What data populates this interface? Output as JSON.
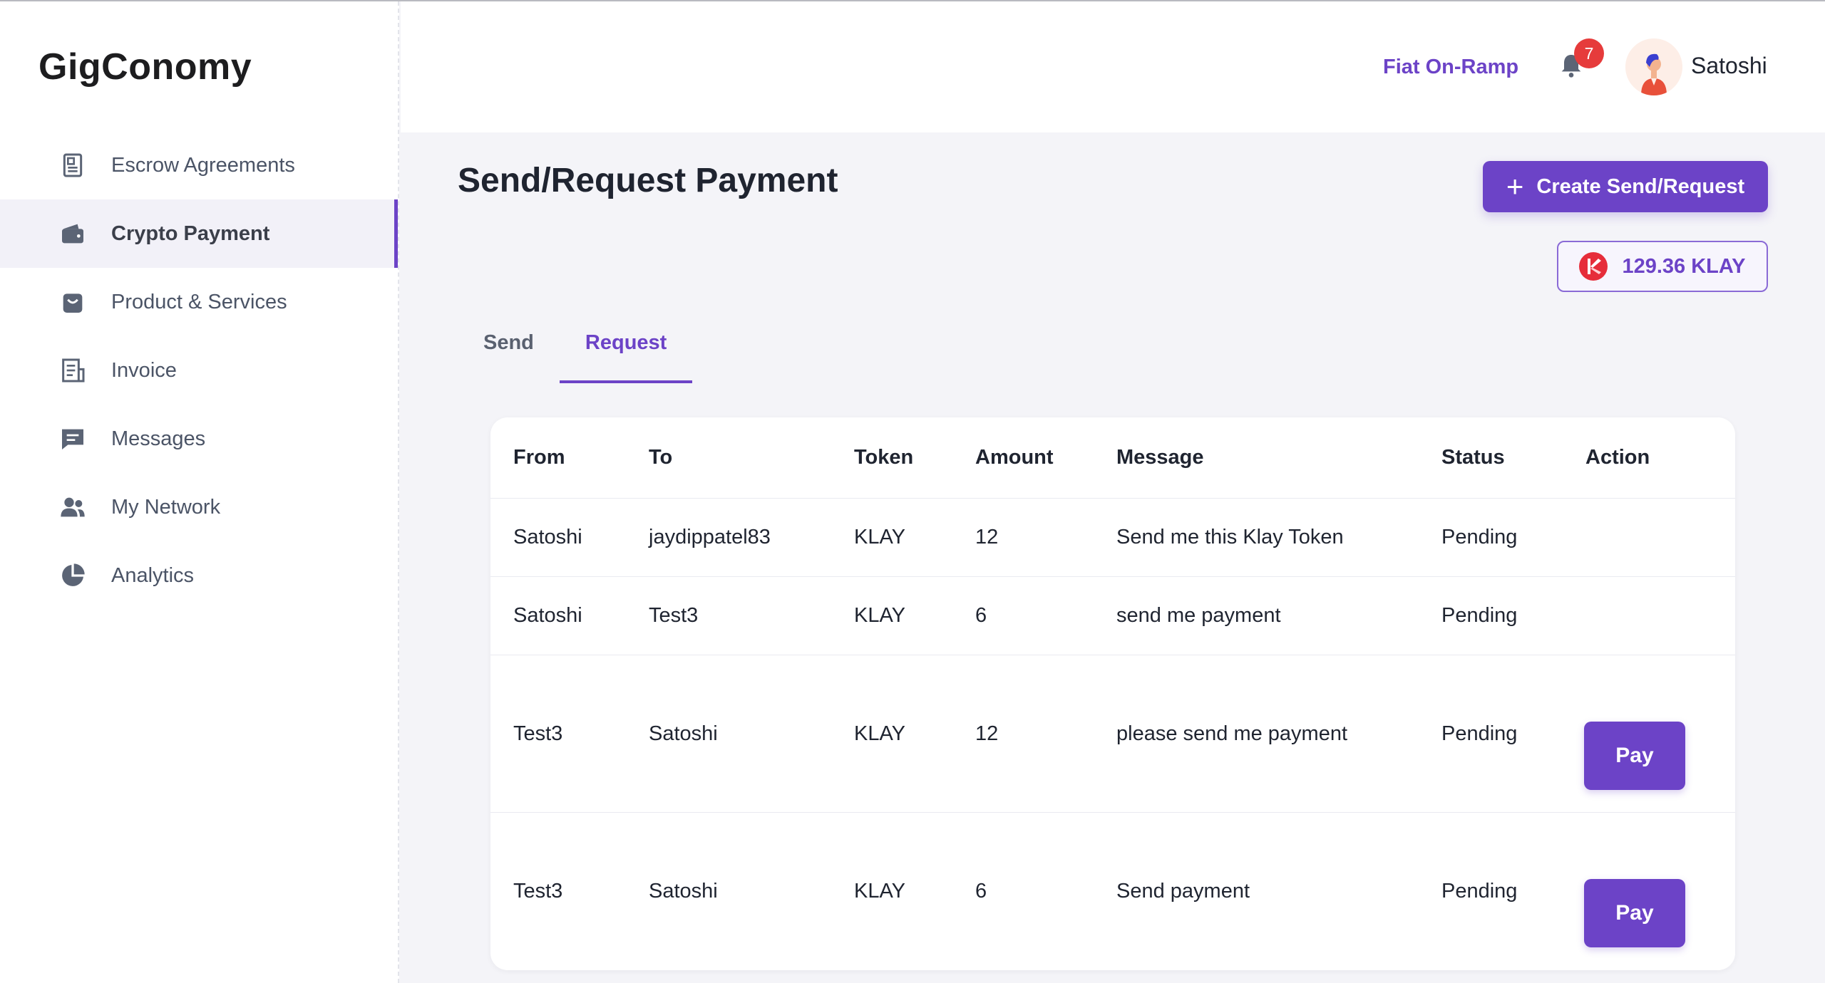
{
  "app": {
    "logo": "GigConomy"
  },
  "sidebar": {
    "items": [
      {
        "label": "Escrow Agreements",
        "icon": "escrow-document-icon"
      },
      {
        "label": "Crypto Payment",
        "icon": "wallet-icon",
        "active": true
      },
      {
        "label": "Product & Services",
        "icon": "shopping-bag-icon"
      },
      {
        "label": "Invoice",
        "icon": "invoice-receipt-icon"
      },
      {
        "label": "Messages",
        "icon": "message-bubble-icon"
      },
      {
        "label": "My Network",
        "icon": "people-icon"
      },
      {
        "label": "Analytics",
        "icon": "pie-chart-icon"
      }
    ]
  },
  "header": {
    "fiat_link": "Fiat On-Ramp",
    "notification_count": "7",
    "username": "Satoshi"
  },
  "main": {
    "title": "Send/Request Payment",
    "create_button": "Create Send/Request",
    "balance": "129.36 KLAY",
    "tabs": [
      {
        "label": "Send",
        "active": false
      },
      {
        "label": "Request",
        "active": true
      }
    ],
    "table": {
      "columns": [
        "From",
        "To",
        "Token",
        "Amount",
        "Message",
        "Status",
        "Action"
      ],
      "rows": [
        {
          "from": "Satoshi",
          "to": "jaydippatel83",
          "token": "KLAY",
          "amount": "12",
          "message": "Send me this Klay Token",
          "status": "Pending",
          "action": ""
        },
        {
          "from": "Satoshi",
          "to": "Test3",
          "token": "KLAY",
          "amount": "6",
          "message": "send me payment",
          "status": "Pending",
          "action": ""
        },
        {
          "from": "Test3",
          "to": "Satoshi",
          "token": "KLAY",
          "amount": "12",
          "message": "please send me payment",
          "status": "Pending",
          "action": "Pay"
        },
        {
          "from": "Test3",
          "to": "Satoshi",
          "token": "KLAY",
          "amount": "6",
          "message": "Send payment",
          "status": "Pending",
          "action": "Pay"
        }
      ]
    }
  },
  "colors": {
    "accent": "#6c43c7",
    "badge": "#e63b3b",
    "sidebar_text": "#4b5466",
    "background": "#f4f4f8"
  }
}
